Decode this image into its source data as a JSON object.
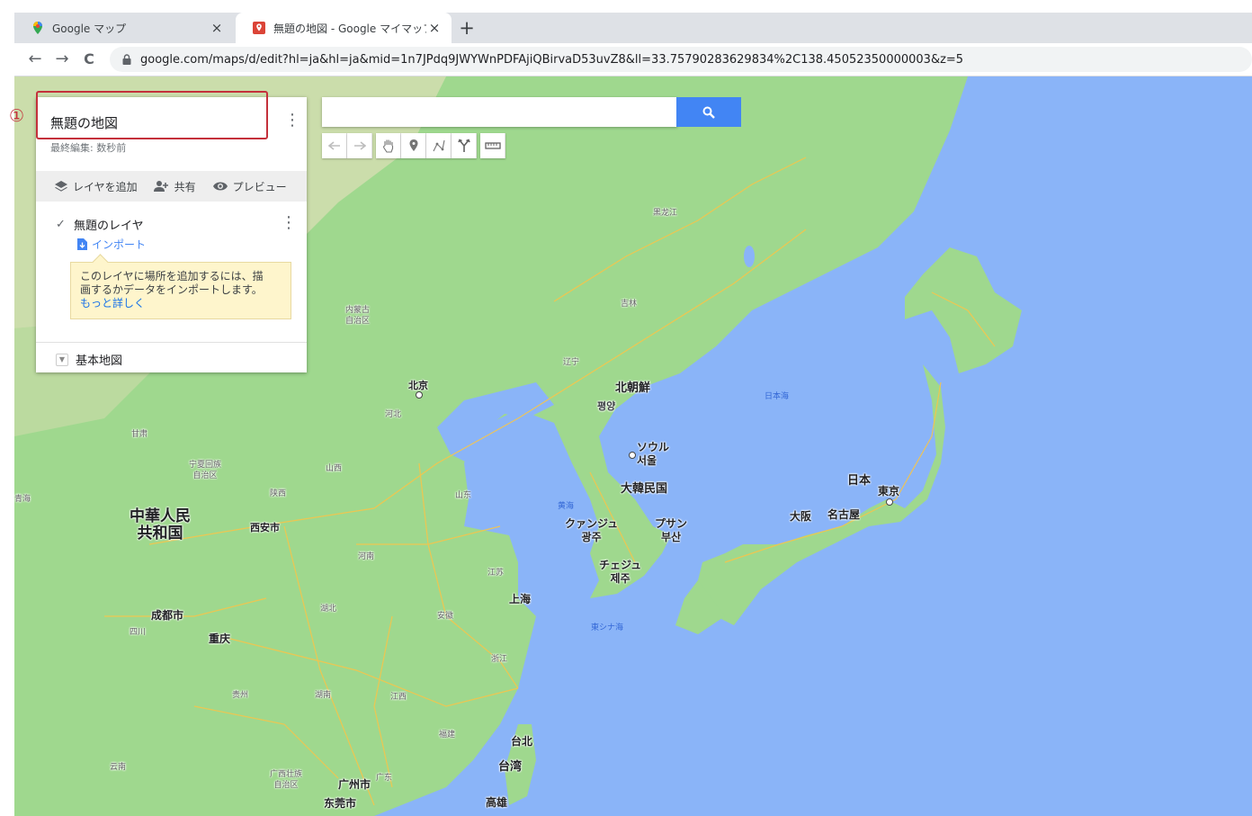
{
  "browser": {
    "tabs": [
      {
        "title": "Google マップ",
        "active": false
      },
      {
        "title": "無題の地図 - Google マイマップ",
        "active": true
      }
    ],
    "close_glyph": "×",
    "new_tab_glyph": "+",
    "nav": {
      "back": "←",
      "forward": "→",
      "reload": "C"
    },
    "url": "google.com/maps/d/edit?hl=ja&hl=ja&mid=1n7JPdq9JWYWnPDFAjiQBirvaD53uvZ8&ll=33.75790283629834%2C138.45052350000003&z=5"
  },
  "annotation": {
    "marker": "①",
    "color": "#c4303b"
  },
  "panel": {
    "map_title": "無題の地図",
    "last_edit": "最終編集: 数秒前",
    "kebab": "⋮",
    "actions": {
      "add_layer": "レイヤを追加",
      "share": "共有",
      "preview": "プレビュー"
    },
    "layer": {
      "checked": true,
      "check_glyph": "✓",
      "name": "無題のレイヤ",
      "import": "インポート"
    },
    "tooltip": {
      "line1": "このレイヤに場所を追加するには、描",
      "line2": "画するかデータをインポートします。",
      "link": "もっと詳しく"
    },
    "base_map": "基本地図",
    "base_map_chevron": "▼"
  },
  "search": {
    "placeholder": "",
    "button_icon": "search-icon"
  },
  "toolbar": [
    "undo-icon",
    "redo-icon",
    "hand-icon",
    "marker-icon",
    "draw-line-icon",
    "directions-icon",
    "ruler-icon"
  ],
  "colors": {
    "land": "#9fd88e",
    "sea": "#8ab4f8",
    "road": "#f6c54b",
    "accent": "#4285f4"
  },
  "map_labels": {
    "countries": {
      "china_1": "中華人民",
      "china_2": "共和国",
      "nk": "北朝鮮",
      "sk": "大韓民国",
      "japan": "日本",
      "taiwan": "台湾"
    },
    "cities": {
      "beijing": "北京",
      "pyongyang": "평양",
      "seoul_ja": "ソウル",
      "seoul_ko": "서울",
      "gwangju_ja": "クァンジュ",
      "gwangju_ko": "광주",
      "busan_ja": "プサン",
      "busan_ko": "부산",
      "jeju_ja": "チェジュ",
      "jeju_ko": "제주",
      "tokyo": "東京",
      "osaka": "大阪",
      "nagoya": "名古屋",
      "shanghai": "上海",
      "xian": "西安市",
      "chengdu": "成都市",
      "chongqing": "重庆",
      "guangzhou": "广州市",
      "dongguan": "东莞市",
      "taipei": "台北",
      "kaohsiung": "高雄"
    },
    "seas": {
      "japan_sea": "日本海",
      "yellow_sea": "黄海",
      "east_china_sea": "東シナ海"
    },
    "provinces": {
      "heilongjiang": "黑龙江",
      "jilin": "吉林",
      "liaoning": "辽宁",
      "neimenggu_1": "内蒙古",
      "neimenggu_2": "自治区",
      "hebei": "河北",
      "shanxi": "山西",
      "shandong": "山东",
      "gansu": "甘肃",
      "ningxia_1": "宁夏回族",
      "ningxia_2": "自治区",
      "shaanxi": "陕西",
      "henan": "河南",
      "jiangsu": "江苏",
      "anhui": "安徽",
      "hubei": "湖北",
      "sichuan": "四川",
      "zhejiang": "浙江",
      "hunan": "湖南",
      "jiangxi": "江西",
      "guizhou": "贵州",
      "fujian": "福建",
      "yunnan": "云南",
      "guangxi_1": "广西壮族",
      "guangxi_2": "自治区",
      "guangdong": "广东",
      "qinghai": "青海"
    }
  }
}
